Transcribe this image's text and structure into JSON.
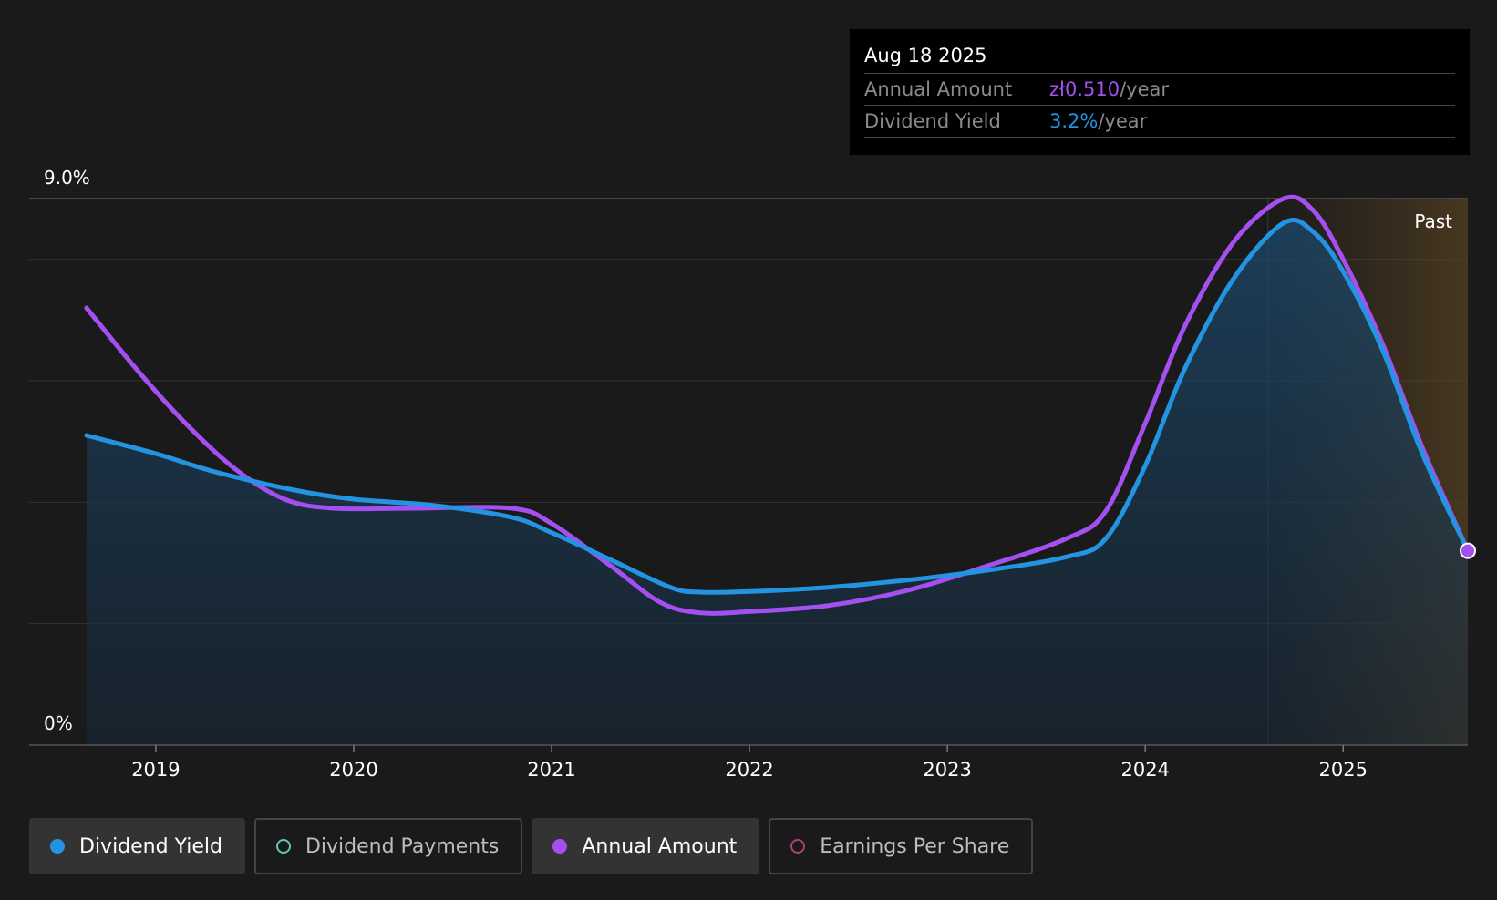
{
  "tooltip": {
    "date": "Aug 18 2025",
    "annual_amount_label": "Annual Amount",
    "annual_amount_value": "zł0.510",
    "annual_amount_unit": "/year",
    "dividend_yield_label": "Dividend Yield",
    "dividend_yield_value": "3.2%",
    "dividend_yield_unit": "/year"
  },
  "past_label": "Past",
  "legend": [
    {
      "label": "Dividend Yield",
      "color": "#2394e1",
      "filled": true,
      "active": true
    },
    {
      "label": "Dividend Payments",
      "color": "#5fc9b6",
      "filled": false,
      "active": false
    },
    {
      "label": "Annual Amount",
      "color": "#a44ff0",
      "filled": true,
      "active": true
    },
    {
      "label": "Earnings Per Share",
      "color": "#b03e7a",
      "filled": false,
      "active": false
    }
  ],
  "colors": {
    "background": "#1a1a1a",
    "dividend_yield": "#2394e1",
    "annual_amount": "#a44ff0",
    "grid": "#3a3a3a",
    "past_region": "#4a3a20"
  },
  "chart_data": {
    "type": "line",
    "ylim": [
      0,
      9.0
    ],
    "y_tick_labels": [
      "0%",
      "9.0%"
    ],
    "xlim": [
      2018.36,
      2025.63
    ],
    "x_ticks": [
      2019,
      2020,
      2021,
      2022,
      2023,
      2024,
      2025
    ],
    "x_tick_labels": [
      "2019",
      "2020",
      "2021",
      "2022",
      "2023",
      "2024",
      "2025"
    ],
    "past_region_start": 2024.62,
    "highlight_date": "Aug 18 2025",
    "series": [
      {
        "name": "Dividend Yield",
        "unit": "%",
        "filled": true,
        "points": [
          [
            2018.65,
            5.1
          ],
          [
            2019.0,
            4.8
          ],
          [
            2019.3,
            4.5
          ],
          [
            2019.7,
            4.2
          ],
          [
            2020.0,
            4.05
          ],
          [
            2020.4,
            3.95
          ],
          [
            2020.8,
            3.75
          ],
          [
            2021.0,
            3.5
          ],
          [
            2021.3,
            3.05
          ],
          [
            2021.6,
            2.6
          ],
          [
            2021.75,
            2.52
          ],
          [
            2022.0,
            2.53
          ],
          [
            2022.4,
            2.6
          ],
          [
            2022.8,
            2.72
          ],
          [
            2023.2,
            2.88
          ],
          [
            2023.6,
            3.1
          ],
          [
            2023.8,
            3.4
          ],
          [
            2024.0,
            4.6
          ],
          [
            2024.2,
            6.2
          ],
          [
            2024.45,
            7.7
          ],
          [
            2024.7,
            8.6
          ],
          [
            2024.85,
            8.45
          ],
          [
            2025.0,
            7.8
          ],
          [
            2025.2,
            6.5
          ],
          [
            2025.4,
            4.8
          ],
          [
            2025.63,
            3.2
          ]
        ]
      },
      {
        "name": "Annual Amount",
        "unit": "zł",
        "filled": false,
        "points": [
          [
            2018.65,
            7.2
          ],
          [
            2018.9,
            6.2
          ],
          [
            2019.15,
            5.3
          ],
          [
            2019.4,
            4.55
          ],
          [
            2019.65,
            4.05
          ],
          [
            2019.9,
            3.9
          ],
          [
            2020.3,
            3.9
          ],
          [
            2020.8,
            3.9
          ],
          [
            2021.0,
            3.65
          ],
          [
            2021.3,
            2.95
          ],
          [
            2021.55,
            2.35
          ],
          [
            2021.75,
            2.18
          ],
          [
            2022.0,
            2.2
          ],
          [
            2022.4,
            2.3
          ],
          [
            2022.8,
            2.55
          ],
          [
            2023.2,
            2.95
          ],
          [
            2023.6,
            3.4
          ],
          [
            2023.8,
            3.85
          ],
          [
            2024.0,
            5.3
          ],
          [
            2024.2,
            6.9
          ],
          [
            2024.45,
            8.3
          ],
          [
            2024.7,
            9.0
          ],
          [
            2024.85,
            8.8
          ],
          [
            2025.0,
            8.0
          ],
          [
            2025.2,
            6.6
          ],
          [
            2025.4,
            4.9
          ],
          [
            2025.63,
            3.2
          ]
        ]
      }
    ]
  }
}
